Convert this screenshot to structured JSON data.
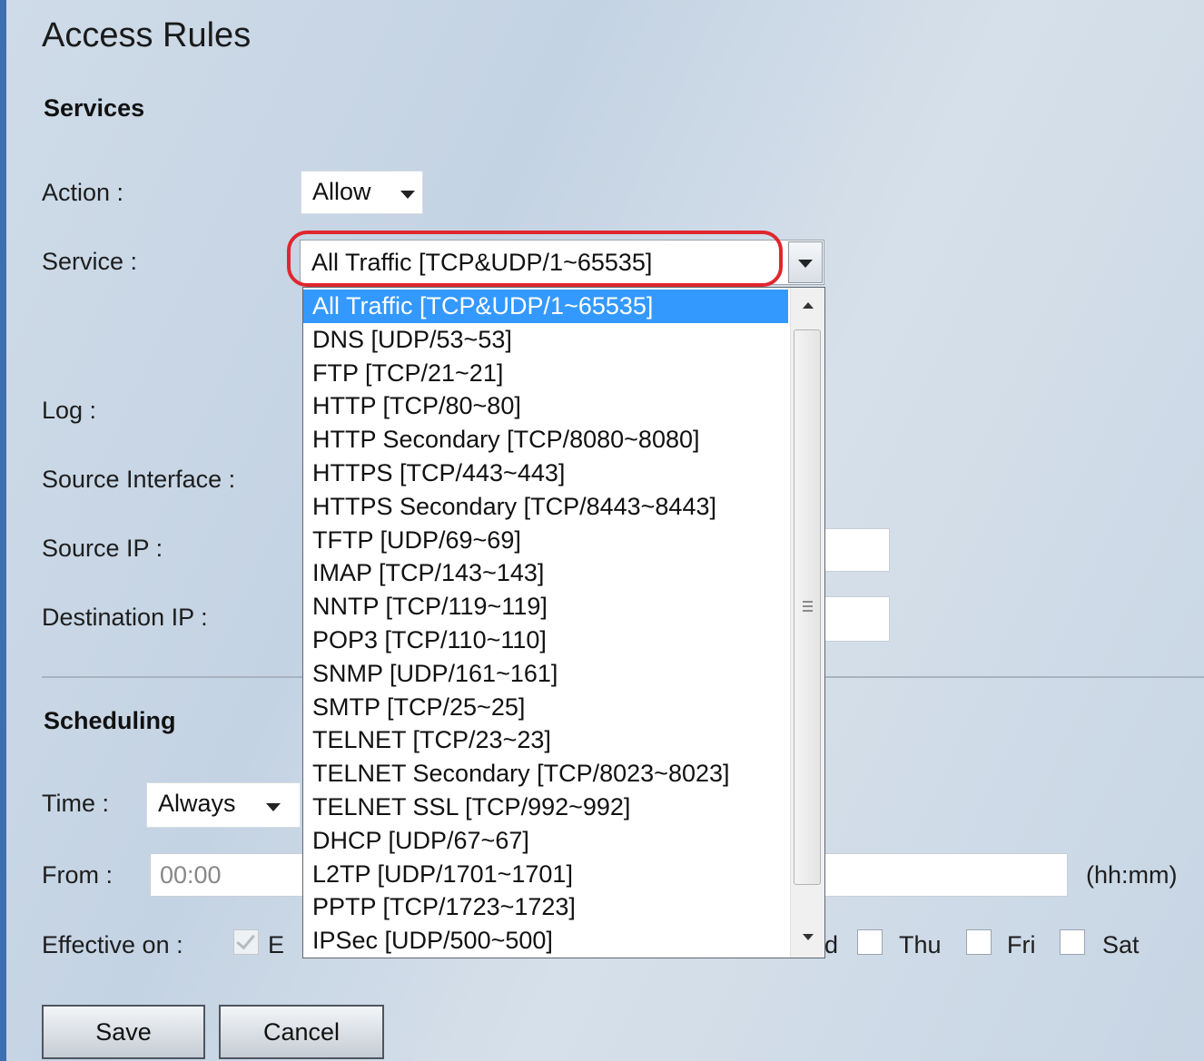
{
  "page": {
    "title": "Access Rules"
  },
  "services": {
    "heading": "Services",
    "action_label": "Action :",
    "action_value": "Allow",
    "service_label": "Service :",
    "service_value": "All Traffic [TCP&UDP/1~65535]",
    "service_options": [
      "All Traffic [TCP&UDP/1~65535]",
      "DNS [UDP/53~53]",
      "FTP [TCP/21~21]",
      "HTTP [TCP/80~80]",
      "HTTP Secondary [TCP/8080~8080]",
      "HTTPS [TCP/443~443]",
      "HTTPS Secondary [TCP/8443~8443]",
      "TFTP [UDP/69~69]",
      "IMAP [TCP/143~143]",
      "NNTP [TCP/119~119]",
      "POP3 [TCP/110~110]",
      "SNMP [UDP/161~161]",
      "SMTP [TCP/25~25]",
      "TELNET [TCP/23~23]",
      "TELNET Secondary [TCP/8023~8023]",
      "TELNET SSL [TCP/992~992]",
      "DHCP [UDP/67~67]",
      "L2TP [UDP/1701~1701]",
      "PPTP [TCP/1723~1723]",
      "IPSec [UDP/500~500]"
    ],
    "log_label": "Log :",
    "source_interface_label": "Source Interface :",
    "source_ip_label": "Source IP :",
    "destination_ip_label": "Destination IP :"
  },
  "scheduling": {
    "heading": "Scheduling",
    "time_label": "Time :",
    "time_value": "Always",
    "from_label": "From :",
    "from_value": "00:00",
    "to_suffix": "(hh:mm)",
    "effective_label": "Effective on :",
    "everyday_partial": "E",
    "wed_partial": "d",
    "days": {
      "thu": "Thu",
      "fri": "Fri",
      "sat": "Sat"
    }
  },
  "buttons": {
    "save": "Save",
    "cancel": "Cancel"
  },
  "colors": {
    "highlight_ring": "#e0262e",
    "selected_option": "#3399ff",
    "left_bar": "#3e6fb0"
  }
}
